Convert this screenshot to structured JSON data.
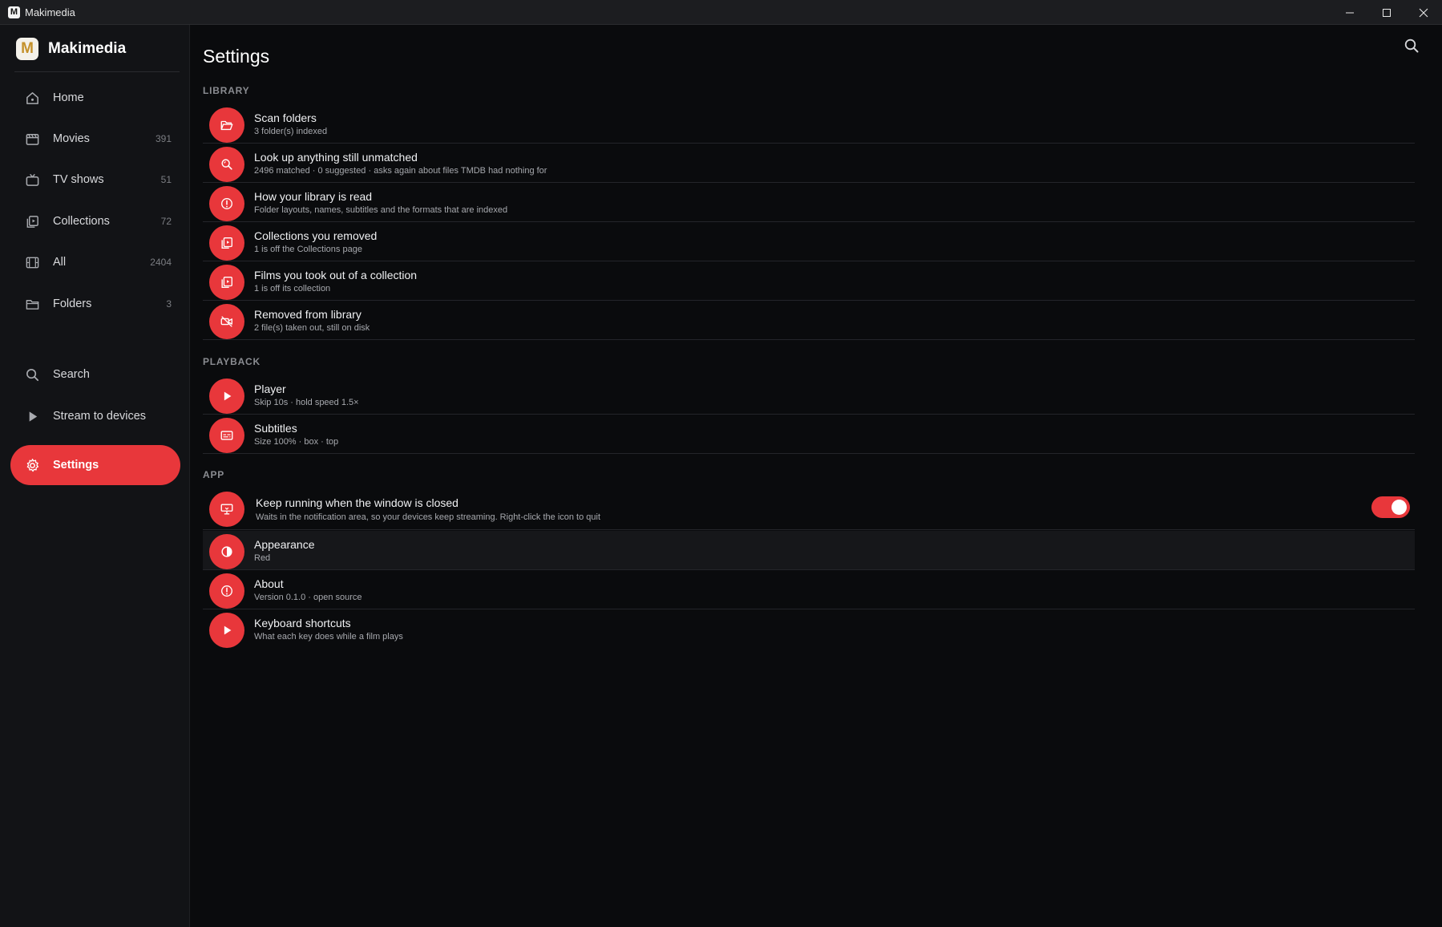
{
  "window": {
    "title": "Makimedia"
  },
  "brand": {
    "name": "Makimedia",
    "logo_letter": "M"
  },
  "sidebar": {
    "items": [
      {
        "label": "Home",
        "count": "",
        "icon": "home-icon"
      },
      {
        "label": "Movies",
        "count": "391",
        "icon": "film-icon"
      },
      {
        "label": "TV shows",
        "count": "51",
        "icon": "tv-icon"
      },
      {
        "label": "Collections",
        "count": "72",
        "icon": "collections-icon"
      },
      {
        "label": "All",
        "count": "2404",
        "icon": "filmstrip-icon"
      },
      {
        "label": "Folders",
        "count": "3",
        "icon": "folder-icon"
      }
    ],
    "secondary": [
      {
        "label": "Search",
        "icon": "search-icon"
      },
      {
        "label": "Stream to devices",
        "icon": "play-icon"
      },
      {
        "label": "Settings",
        "icon": "gear-icon",
        "active": true
      }
    ]
  },
  "main": {
    "title": "Settings",
    "sections": {
      "library": {
        "header": "LIBRARY",
        "rows": [
          {
            "title": "Scan folders",
            "subtitle": "3 folder(s) indexed",
            "icon": "folder-open-icon"
          },
          {
            "title": "Look up anything still unmatched",
            "subtitle": "2496 matched · 0 suggested · asks again about files TMDB had nothing for",
            "icon": "search-icon"
          },
          {
            "title": "How your library is read",
            "subtitle": "Folder layouts, names, subtitles and the formats that are indexed",
            "icon": "info-icon"
          },
          {
            "title": "Collections you removed",
            "subtitle": "1 is off the Collections page",
            "icon": "collections-icon"
          },
          {
            "title": "Films you took out of a collection",
            "subtitle": "1 is off its collection",
            "icon": "collections-icon"
          },
          {
            "title": "Removed from library",
            "subtitle": "2 file(s) taken out, still on disk",
            "icon": "video-off-icon"
          }
        ]
      },
      "playback": {
        "header": "PLAYBACK",
        "rows": [
          {
            "title": "Player",
            "subtitle": "Skip 10s · hold speed 1.5×",
            "icon": "play-icon"
          },
          {
            "title": "Subtitles",
            "subtitle": "Size 100% · box · top",
            "icon": "subtitles-icon"
          }
        ]
      },
      "app": {
        "header": "APP",
        "rows": [
          {
            "title": "Keep running when the window is closed",
            "subtitle": "Waits in the notification area, so your devices keep streaming. Right-click the icon to quit",
            "icon": "tray-icon",
            "toggle": true
          },
          {
            "title": "Appearance",
            "subtitle": "Red",
            "icon": "contrast-icon"
          },
          {
            "title": "About",
            "subtitle": "Version 0.1.0 · open source",
            "icon": "info-icon"
          },
          {
            "title": "Keyboard shortcuts",
            "subtitle": "What each key does while a film plays",
            "icon": "play-icon"
          }
        ]
      }
    }
  },
  "colors": {
    "accent": "#e8373b",
    "background": "#0a0b0d",
    "sidebar": "#121316"
  }
}
